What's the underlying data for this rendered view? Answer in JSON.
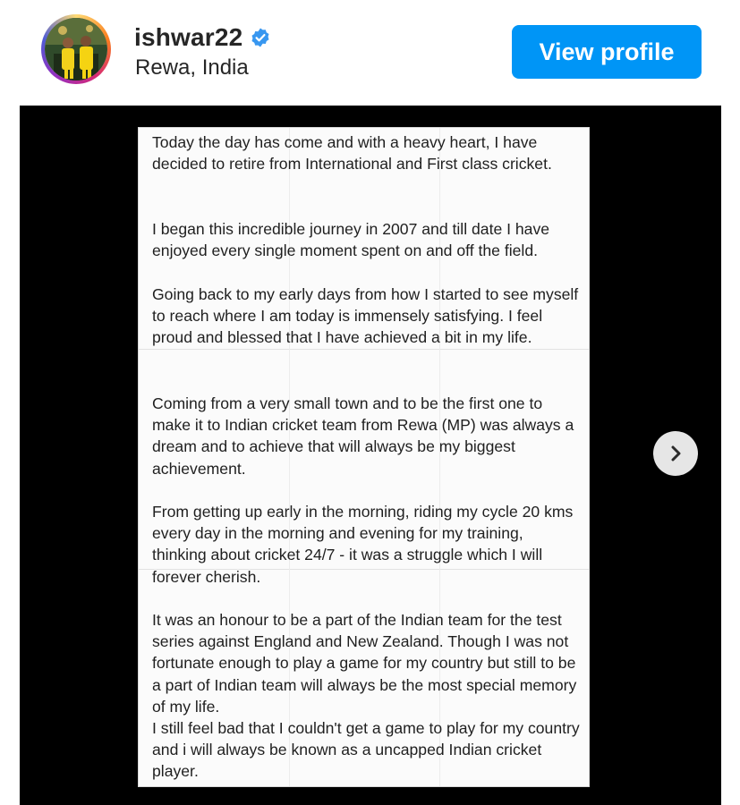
{
  "header": {
    "username": "ishwar22",
    "location": "Rewa, India",
    "view_profile_label": "View profile",
    "verified_icon": "verified-badge-icon",
    "verified_color": "#3897f0",
    "button_color": "#0095f6"
  },
  "post": {
    "paragraphs": [
      "Today the day has come and with a heavy heart, I have decided to retire from International and First class cricket.",
      "I began this incredible journey in 2007 and till date I have enjoyed every single moment spent on and off the field.",
      "Going back to my early days from how I started to see myself to reach where I am today is immensely satisfying. I feel proud and blessed that I have achieved a bit in my life.",
      "Coming from a very small town and to be the first one to make it to Indian cricket team from Rewa (MP) was always a dream and to achieve that will always be my biggest achievement.",
      "From getting up early in the morning, riding my cycle 20 kms every day in the morning and evening for my training, thinking about cricket 24/7 - it was a struggle which I will forever cherish.",
      "It was an honour to be a part of the Indian team for the test series against England and New Zealand. Though I was not fortunate enough to play a game for my country but still to be a part of Indian team will always be the most special memory of my life.",
      "I still feel bad that I couldn't get a game to play for my country and i will always be known as a uncapped Indian cricket player."
    ],
    "next_icon": "chevron-right-icon"
  }
}
